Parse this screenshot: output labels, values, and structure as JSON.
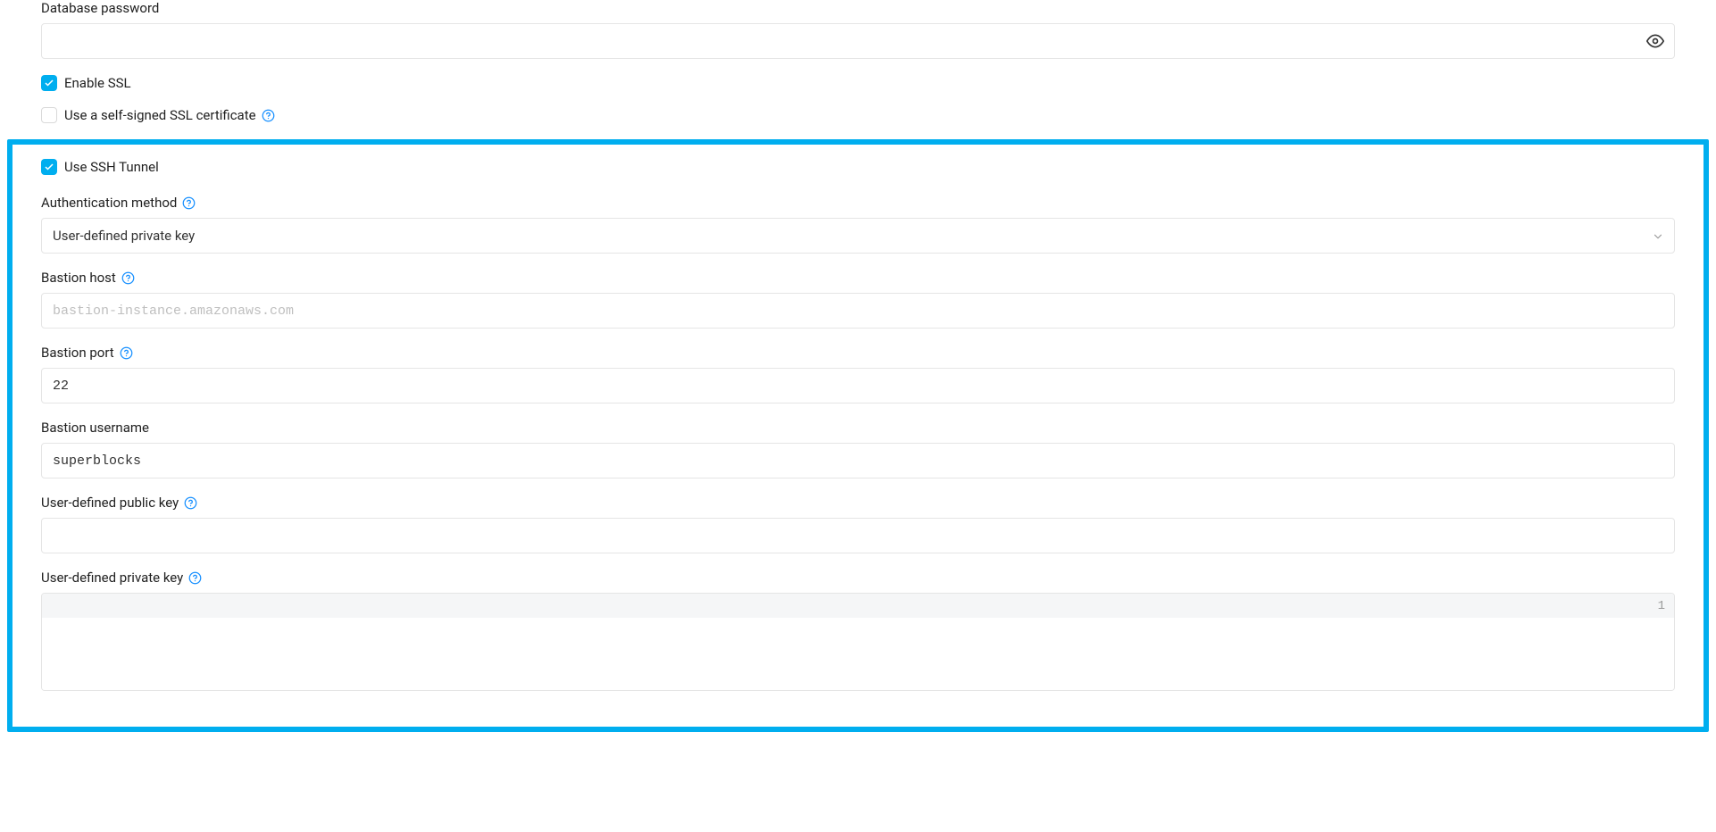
{
  "fields": {
    "dbPasswordLabel": "Database password",
    "dbPasswordValue": "",
    "enableSslLabel": "Enable SSL",
    "selfSignedLabel": "Use a self-signed SSL certificate",
    "useSshTunnelLabel": "Use SSH Tunnel",
    "authMethodLabel": "Authentication method",
    "authMethodValue": "User-defined private key",
    "bastionHostLabel": "Bastion host",
    "bastionHostPlaceholder": "bastion-instance.amazonaws.com",
    "bastionHostValue": "",
    "bastionPortLabel": "Bastion port",
    "bastionPortValue": "22",
    "bastionUsernameLabel": "Bastion username",
    "bastionUsernameValue": "superblocks",
    "publicKeyLabel": "User-defined public key",
    "publicKeyValue": "",
    "privateKeyLabel": "User-defined private key",
    "privateKeyLineNum": "1",
    "privateKeyContent": ""
  }
}
